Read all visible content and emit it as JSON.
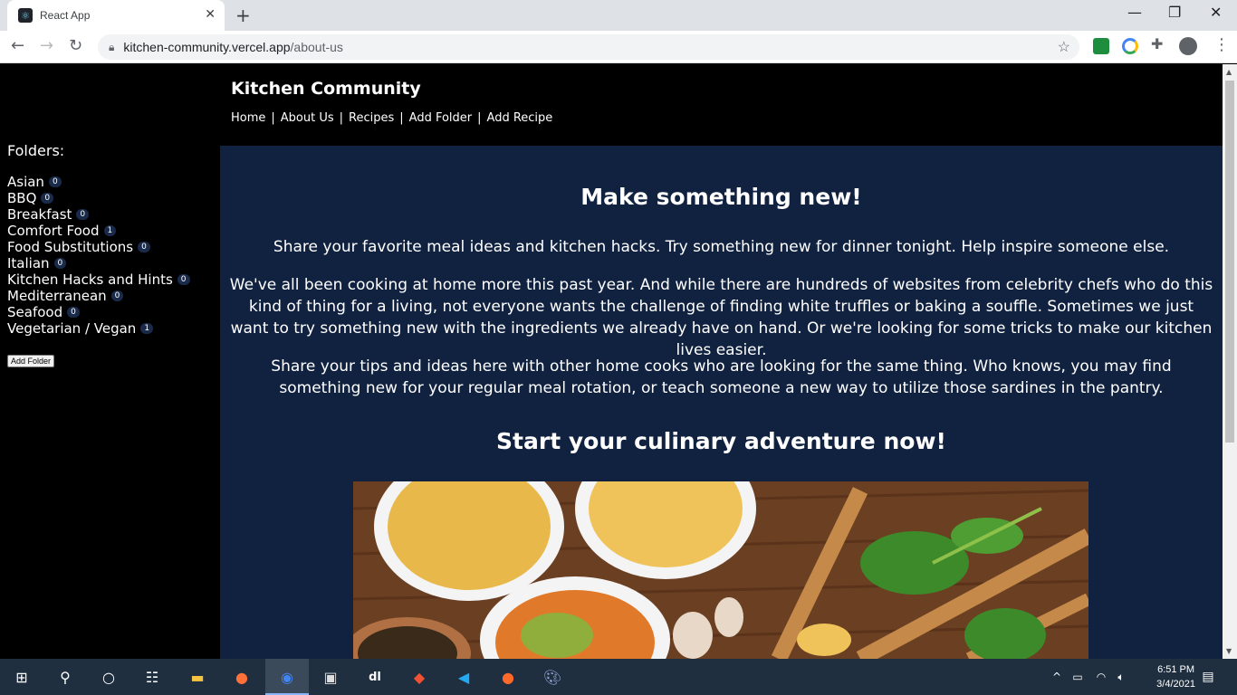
{
  "browser": {
    "tab_title": "React App",
    "url_host": "kitchen-community.vercel.app",
    "url_path": "/about-us"
  },
  "site": {
    "title": "Kitchen Community",
    "nav": [
      "Home",
      "About Us",
      "Recipes",
      "Add Folder",
      "Add Recipe"
    ]
  },
  "sidebar": {
    "heading": "Folders:",
    "folders": [
      {
        "name": "Asian",
        "count": "0"
      },
      {
        "name": "BBQ",
        "count": "0"
      },
      {
        "name": "Breakfast",
        "count": "0"
      },
      {
        "name": "Comfort Food",
        "count": "1"
      },
      {
        "name": "Food Substitutions",
        "count": "0"
      },
      {
        "name": "Italian",
        "count": "0"
      },
      {
        "name": "Kitchen Hacks and Hints",
        "count": "0"
      },
      {
        "name": "Mediterranean",
        "count": "0"
      },
      {
        "name": "Seafood",
        "count": "0"
      },
      {
        "name": "Vegetarian / Vegan",
        "count": "1"
      }
    ],
    "add_button": "Add Folder"
  },
  "main": {
    "heading": "Make something new!",
    "p1": "Share your favorite meal ideas and kitchen hacks. Try something new for dinner tonight. Help inspire someone else.",
    "p2": "We've all been cooking at home more this past year. And while there are hundreds of websites from celebrity chefs who do this kind of thing for a living, not everyone wants the challenge of finding white truffles or baking a souffle. Sometimes we just want to try something new with the ingredients we already have on hand. Or we're looking for some tricks to make our kitchen lives easier.",
    "p3": "Share your tips and ideas here with other home cooks who are looking for the same thing. Who knows, you may find something new for your regular meal rotation, or teach someone a new way to utilize those sardines in the pantry.",
    "subheading": "Start your culinary adventure now!"
  },
  "taskbar": {
    "time": "6:51 PM",
    "date": "3/4/2021"
  }
}
